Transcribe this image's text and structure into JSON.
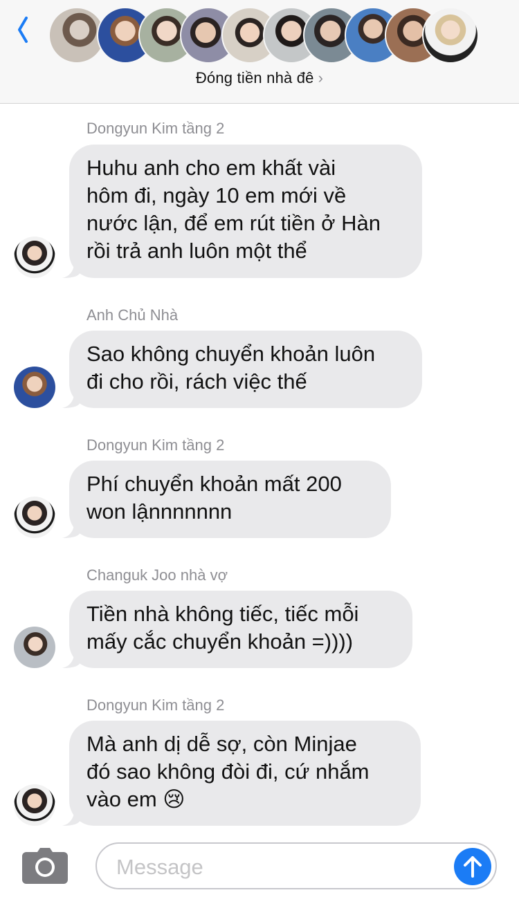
{
  "header": {
    "back_icon": "chevron-left-icon",
    "group_title": "Đóng tiền nhà đê",
    "chevron": "›",
    "accent": "#1b7cf5",
    "avatar_count": 10
  },
  "messages": [
    {
      "sender": "Dongyun Kim tầng 2",
      "lines": [
        "Huhu anh cho em khất vài",
        "hôm đi, ngày 10 em mới về",
        "nước lận, để em rút tiền ở Hàn",
        "rồi trả anh luôn một thể"
      ]
    },
    {
      "sender": "Anh Chủ Nhà",
      "lines": [
        "Sao không chuyển khoản luôn",
        "đi cho rồi, rách việc thế"
      ]
    },
    {
      "sender": "Dongyun Kim tầng 2",
      "lines": [
        "Phí chuyển khoản mất 200",
        "won lậnnnnnnn"
      ]
    },
    {
      "sender": "Changuk Joo nhà vợ",
      "lines": [
        "Tiền nhà không tiếc, tiếc mỗi",
        "mấy cắc chuyển khoản =))))"
      ]
    },
    {
      "sender": "Dongyun Kim tầng 2",
      "lines": [
        "Mà anh dị dễ sợ, còn Minjae",
        "đó sao không đòi đi, cứ nhắm",
        "vào em 😢"
      ]
    }
  ],
  "composer": {
    "camera_icon": "camera-icon",
    "placeholder": "Message",
    "send_icon": "arrow-up-icon"
  },
  "colors": {
    "bubble": "#e9e9eb",
    "sender": "#8e8e93",
    "header_bg": "#f7f7f7",
    "send": "#1b7cf5"
  }
}
